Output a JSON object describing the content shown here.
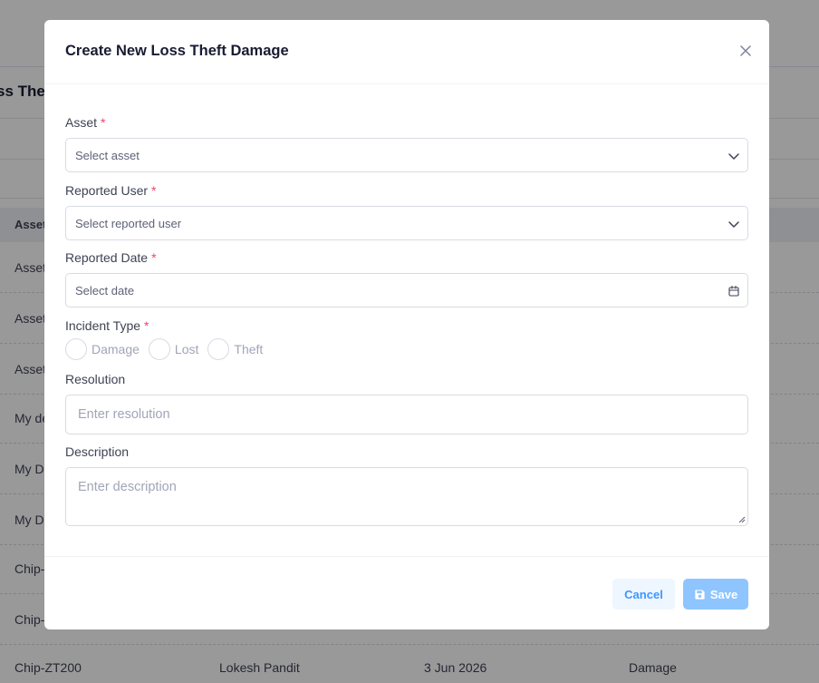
{
  "background": {
    "page_title": "ss The",
    "table_head_first": "Asset",
    "rows": [
      {
        "c1": "Asset"
      },
      {
        "c1": "Asset"
      },
      {
        "c1": "Asset"
      },
      {
        "c1": "My de"
      },
      {
        "c1": "My D"
      },
      {
        "c1": "My D"
      },
      {
        "c1": "Chip-"
      },
      {
        "c1": "Chip-"
      }
    ],
    "last_row": {
      "asset": "Chip-ZT200",
      "user": "Lokesh Pandit",
      "date": "3 Jun 2026",
      "type": "Damage"
    }
  },
  "modal": {
    "title": "Create New Loss Theft Damage",
    "asset": {
      "label": "Asset",
      "required": "*",
      "placeholder": "Select asset"
    },
    "reported_user": {
      "label": "Reported User",
      "required": "*",
      "placeholder": "Select reported user"
    },
    "reported_date": {
      "label": "Reported Date",
      "required": "*",
      "placeholder": "Select date"
    },
    "incident_type": {
      "label": "Incident Type",
      "required": "*",
      "options": [
        "Damage",
        "Lost",
        "Theft"
      ]
    },
    "resolution": {
      "label": "Resolution",
      "placeholder": "Enter resolution"
    },
    "description": {
      "label": "Description",
      "placeholder": "Enter description"
    },
    "cancel_label": "Cancel",
    "save_label": "Save"
  },
  "icons": {
    "close": "close-icon",
    "chevron": "chevron-down-icon",
    "calendar": "calendar-icon",
    "save": "floppy-disk-icon"
  },
  "colors": {
    "required": "#f1416c",
    "primary": "#3e97ff",
    "save_button": "#8ec5ff",
    "cancel_bg": "#eef6ff"
  }
}
